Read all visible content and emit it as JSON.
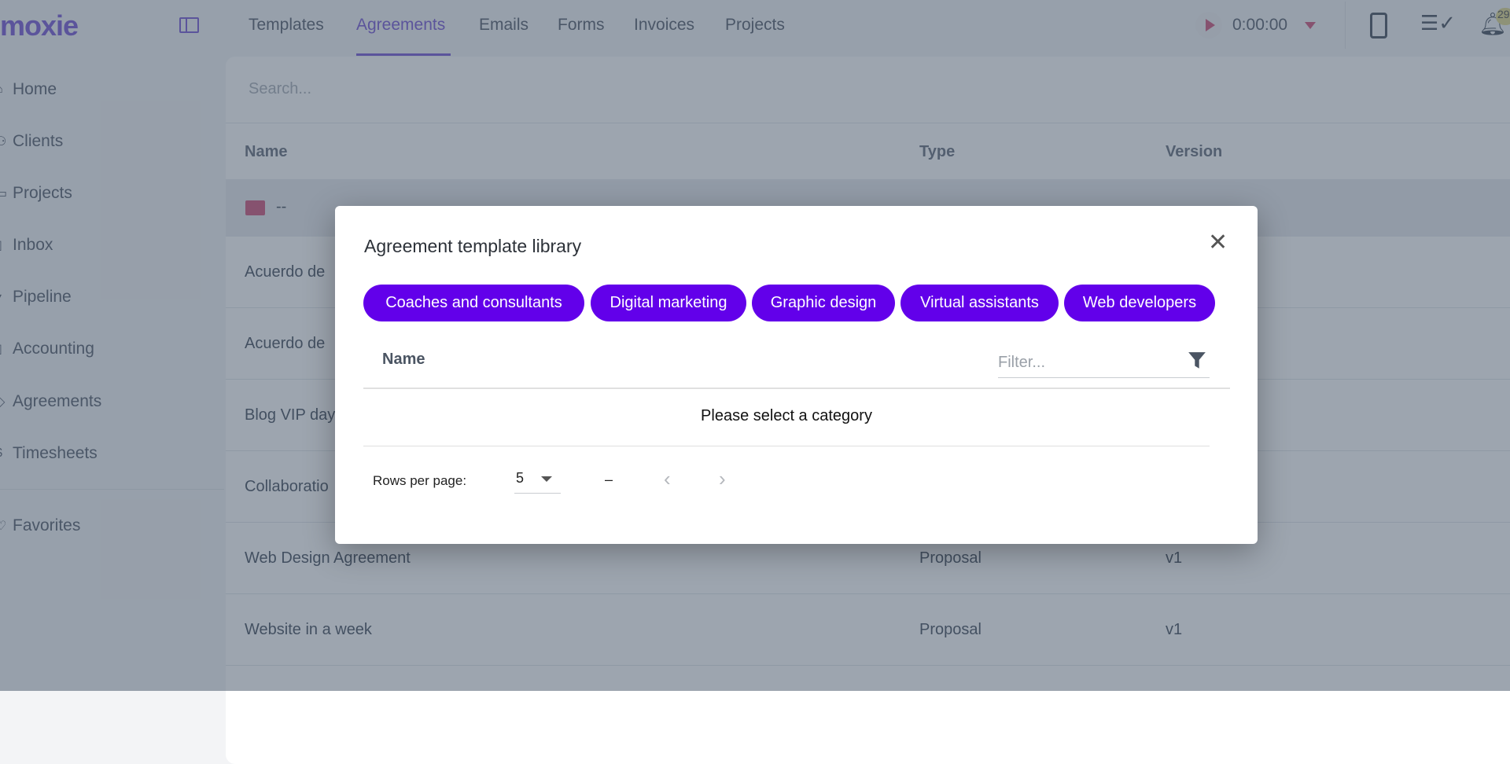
{
  "app": {
    "logo": "moxie"
  },
  "topnav": {
    "tabs": [
      {
        "label": "Templates"
      },
      {
        "label": "Agreements",
        "active": true
      },
      {
        "label": "Emails"
      },
      {
        "label": "Forms"
      },
      {
        "label": "Invoices"
      },
      {
        "label": "Projects"
      }
    ],
    "timer": "0:00:00",
    "notification_count": "29"
  },
  "sidebar": {
    "items": [
      {
        "label": "Home",
        "icon": "home-icon"
      },
      {
        "label": "Clients",
        "icon": "clients-icon"
      },
      {
        "label": "Projects",
        "icon": "projects-icon"
      },
      {
        "label": "Inbox",
        "icon": "inbox-icon"
      },
      {
        "label": "Pipeline",
        "icon": "pipeline-icon"
      },
      {
        "label": "Accounting",
        "icon": "accounting-icon"
      },
      {
        "label": "Agreements",
        "icon": "agreements-icon"
      },
      {
        "label": "Timesheets",
        "icon": "timesheets-icon"
      }
    ],
    "favorites": "Favorites"
  },
  "main": {
    "search_placeholder": "Search...",
    "columns": {
      "name": "Name",
      "type": "Type",
      "version": "Version"
    },
    "folder": "--",
    "rows": [
      {
        "name": "Acuerdo de",
        "type": "",
        "version": ""
      },
      {
        "name": "Acuerdo de",
        "type": "",
        "version": ""
      },
      {
        "name": "Blog VIP day",
        "type": "",
        "version": ""
      },
      {
        "name": "Collaboratio",
        "type": "",
        "version": ""
      },
      {
        "name": "Web Design Agreement",
        "type": "Proposal",
        "version": "v1"
      },
      {
        "name": "Website in a week",
        "type": "Proposal",
        "version": "v1"
      }
    ]
  },
  "modal": {
    "title": "Agreement template library",
    "categories": [
      "Coaches and consultants",
      "Digital marketing",
      "Graphic design",
      "Virtual assistants",
      "Web developers"
    ],
    "column_name": "Name",
    "filter_placeholder": "Filter...",
    "empty_text": "Please select a category",
    "rows_per_page_label": "Rows per page:",
    "rows_per_page": "5",
    "range": "–"
  },
  "colors": {
    "accent": "#7b5cd6",
    "chip": "#6200ea"
  }
}
